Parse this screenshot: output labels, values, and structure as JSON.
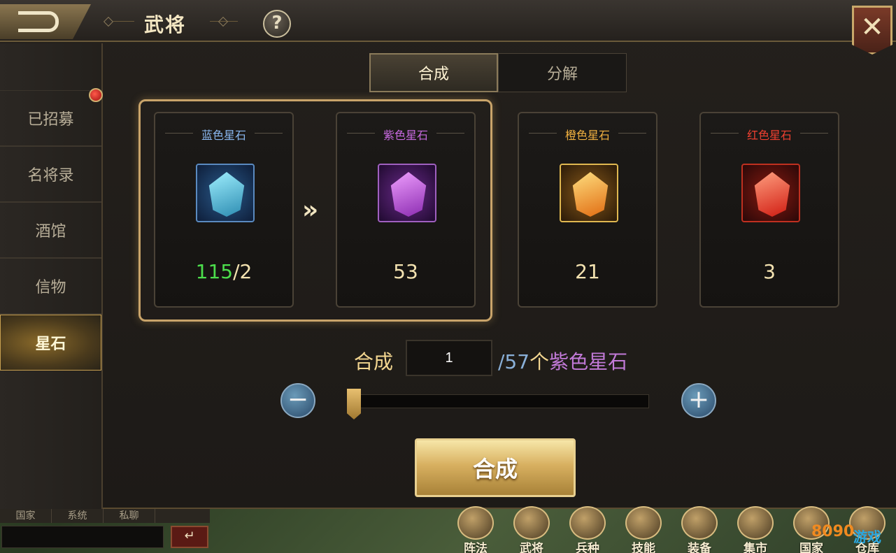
{
  "header": {
    "title": "武将",
    "help_icon": "?",
    "close_icon": "✕"
  },
  "sidebar": {
    "items": [
      {
        "label": "已招募"
      },
      {
        "label": "名将录"
      },
      {
        "label": "酒馆"
      },
      {
        "label": "信物"
      },
      {
        "label": "星石",
        "active": true
      }
    ]
  },
  "tabs": [
    {
      "label": "合成",
      "active": true
    },
    {
      "label": "分解"
    }
  ],
  "stones": [
    {
      "name": "蓝色星石",
      "color": "#8ab8f0",
      "count_have": "115",
      "count_need": "/2",
      "count_have_color": "#4cde4c"
    },
    {
      "name": "紫色星石",
      "color": "#c86ae0",
      "count": "53"
    },
    {
      "name": "橙色星石",
      "color": "#f0b040",
      "count": "21"
    },
    {
      "name": "红色星石",
      "color": "#f04030",
      "count": "3"
    }
  ],
  "arrow_icon": "»",
  "synth": {
    "label": "合成",
    "quantity": "1",
    "max_prefix": "/57",
    "unit": "个",
    "item": "紫色星石",
    "minus_icon": "−",
    "plus_icon": "+",
    "slider_level": 0,
    "button_label": "合成"
  },
  "chat": {
    "tabs": [
      "国家",
      "系统",
      "私聊"
    ],
    "send_icon": "↵"
  },
  "bottom_menu": [
    {
      "label": "阵法"
    },
    {
      "label": "武将"
    },
    {
      "label": "兵种"
    },
    {
      "label": "技能"
    },
    {
      "label": "装备"
    },
    {
      "label": "集市"
    },
    {
      "label": "国家"
    },
    {
      "label": "仓库"
    }
  ],
  "watermark": {
    "text": "游戏",
    "number": "8090"
  }
}
